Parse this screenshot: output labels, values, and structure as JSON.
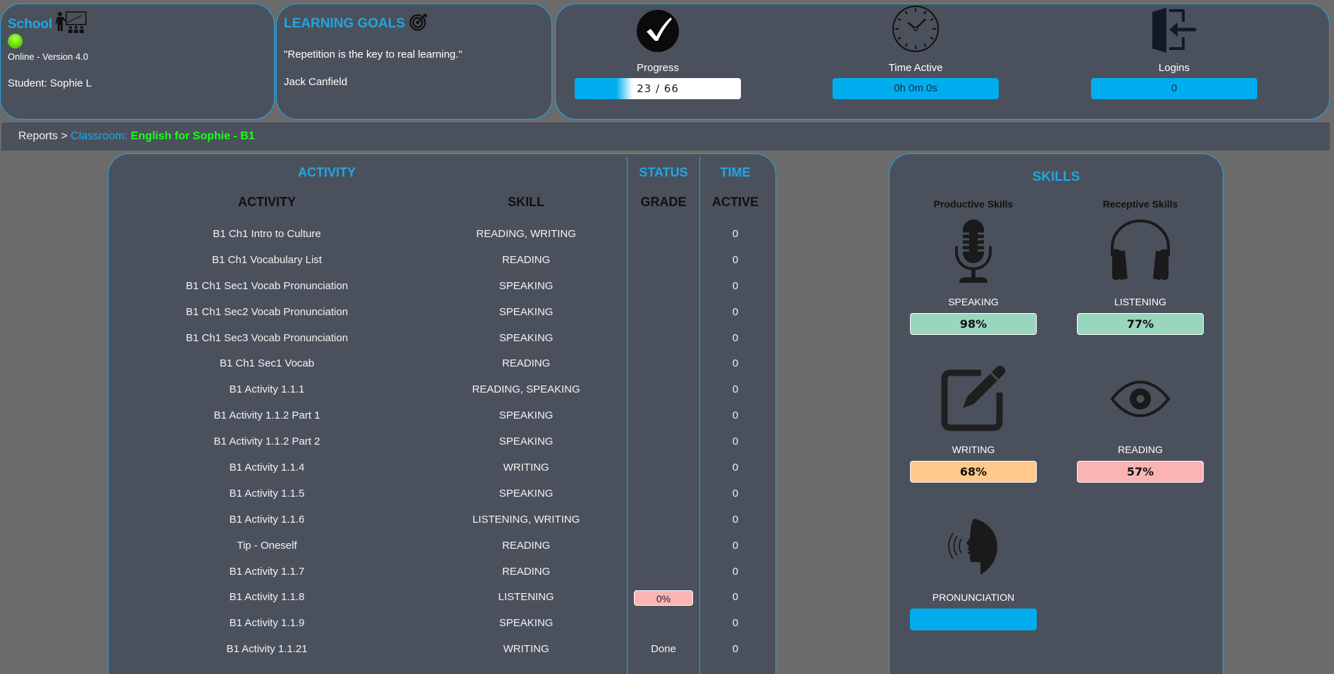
{
  "school_panel": {
    "title": "School",
    "status": "Online - Version 4.0",
    "student": "Student: Sophie L"
  },
  "goals_panel": {
    "title": "LEARNING GOALS",
    "quote": "\"Repetition is the key to real learning.\"",
    "author": "Jack Canfield"
  },
  "stats": {
    "progress": {
      "label": "Progress",
      "value": "23 / 66",
      "completed": 23,
      "total": 66
    },
    "time_active": {
      "label": "Time Active",
      "value": "0h 0m 0s"
    },
    "logins": {
      "label": "Logins",
      "value": "0"
    }
  },
  "breadcrumb": {
    "reports": "Reports",
    "separator": ">",
    "classroom_label": "Classroom:",
    "classroom_name": "English for Sophie - B1"
  },
  "activity_table": {
    "group_headers": {
      "activity": "ACTIVITY",
      "status": "STATUS",
      "time": "TIME"
    },
    "columns": {
      "activity": "ACTIVITY",
      "skill": "SKILL",
      "grade": "GRADE",
      "active": "ACTIVE"
    },
    "rows": [
      {
        "activity": "B1 Ch1 Intro to Culture",
        "skill": "READING, WRITING",
        "grade": "",
        "grade_type": "",
        "time": "0"
      },
      {
        "activity": "B1 Ch1 Vocabulary List",
        "skill": "READING",
        "grade": "",
        "grade_type": "",
        "time": "0"
      },
      {
        "activity": "B1 Ch1 Sec1 Vocab Pronunciation",
        "skill": "SPEAKING",
        "grade": "",
        "grade_type": "",
        "time": "0"
      },
      {
        "activity": "B1 Ch1 Sec2 Vocab Pronunciation",
        "skill": "SPEAKING",
        "grade": "",
        "grade_type": "",
        "time": "0"
      },
      {
        "activity": "B1 Ch1 Sec3 Vocab Pronunciation",
        "skill": "SPEAKING",
        "grade": "",
        "grade_type": "",
        "time": "0"
      },
      {
        "activity": "B1 Ch1 Sec1 Vocab",
        "skill": "READING",
        "grade": "",
        "grade_type": "",
        "time": "0"
      },
      {
        "activity": "B1 Activity 1.1.1",
        "skill": "READING, SPEAKING",
        "grade": "",
        "grade_type": "",
        "time": "0"
      },
      {
        "activity": "B1 Activity 1.1.2 Part 1",
        "skill": "SPEAKING",
        "grade": "",
        "grade_type": "",
        "time": "0"
      },
      {
        "activity": "B1 Activity 1.1.2 Part 2",
        "skill": "SPEAKING",
        "grade": "",
        "grade_type": "",
        "time": "0"
      },
      {
        "activity": "B1 Activity 1.1.4",
        "skill": "WRITING",
        "grade": "",
        "grade_type": "",
        "time": "0"
      },
      {
        "activity": "B1 Activity 1.1.5",
        "skill": "SPEAKING",
        "grade": "",
        "grade_type": "",
        "time": "0"
      },
      {
        "activity": "B1 Activity 1.1.6",
        "skill": "LISTENING, WRITING",
        "grade": "",
        "grade_type": "",
        "time": "0"
      },
      {
        "activity": "Tip - Oneself",
        "skill": "READING",
        "grade": "",
        "grade_type": "",
        "time": "0"
      },
      {
        "activity": "B1 Activity 1.1.7",
        "skill": "READING",
        "grade": "",
        "grade_type": "",
        "time": "0"
      },
      {
        "activity": "B1 Activity 1.1.8",
        "skill": "LISTENING",
        "grade": "0%",
        "grade_type": "badge",
        "time": "0"
      },
      {
        "activity": "B1 Activity 1.1.9",
        "skill": "SPEAKING",
        "grade": "",
        "grade_type": "",
        "time": "0"
      },
      {
        "activity": "B1 Activity 1.1.21",
        "skill": "WRITING",
        "grade": "Done",
        "grade_type": "text",
        "time": "0"
      }
    ]
  },
  "skills_panel": {
    "title": "SKILLS",
    "productive_label": "Productive Skills",
    "receptive_label": "Receptive Skills",
    "skills": {
      "speaking": {
        "label": "SPEAKING",
        "value": "98%",
        "color": "#98d6be",
        "icon": "microphone-icon"
      },
      "listening": {
        "label": "LISTENING",
        "value": "77%",
        "color": "#98d6be",
        "icon": "headphones-icon"
      },
      "writing": {
        "label": "WRITING",
        "value": "68%",
        "color": "#ffc98a",
        "icon": "edit-icon"
      },
      "reading": {
        "label": "READING",
        "value": "57%",
        "color": "#fbb4b4",
        "icon": "eye-icon"
      },
      "pronunciation": {
        "label": "PRONUNCIATION",
        "value": "",
        "color": "#00aeef",
        "icon": "speaking-head-icon"
      }
    }
  },
  "colors": {
    "accent": "#1ea7e1",
    "panel": "#4b515c",
    "background": "#6b6b6b",
    "stat_box": "#00aeef",
    "classroom_name": "#1aff1a"
  }
}
